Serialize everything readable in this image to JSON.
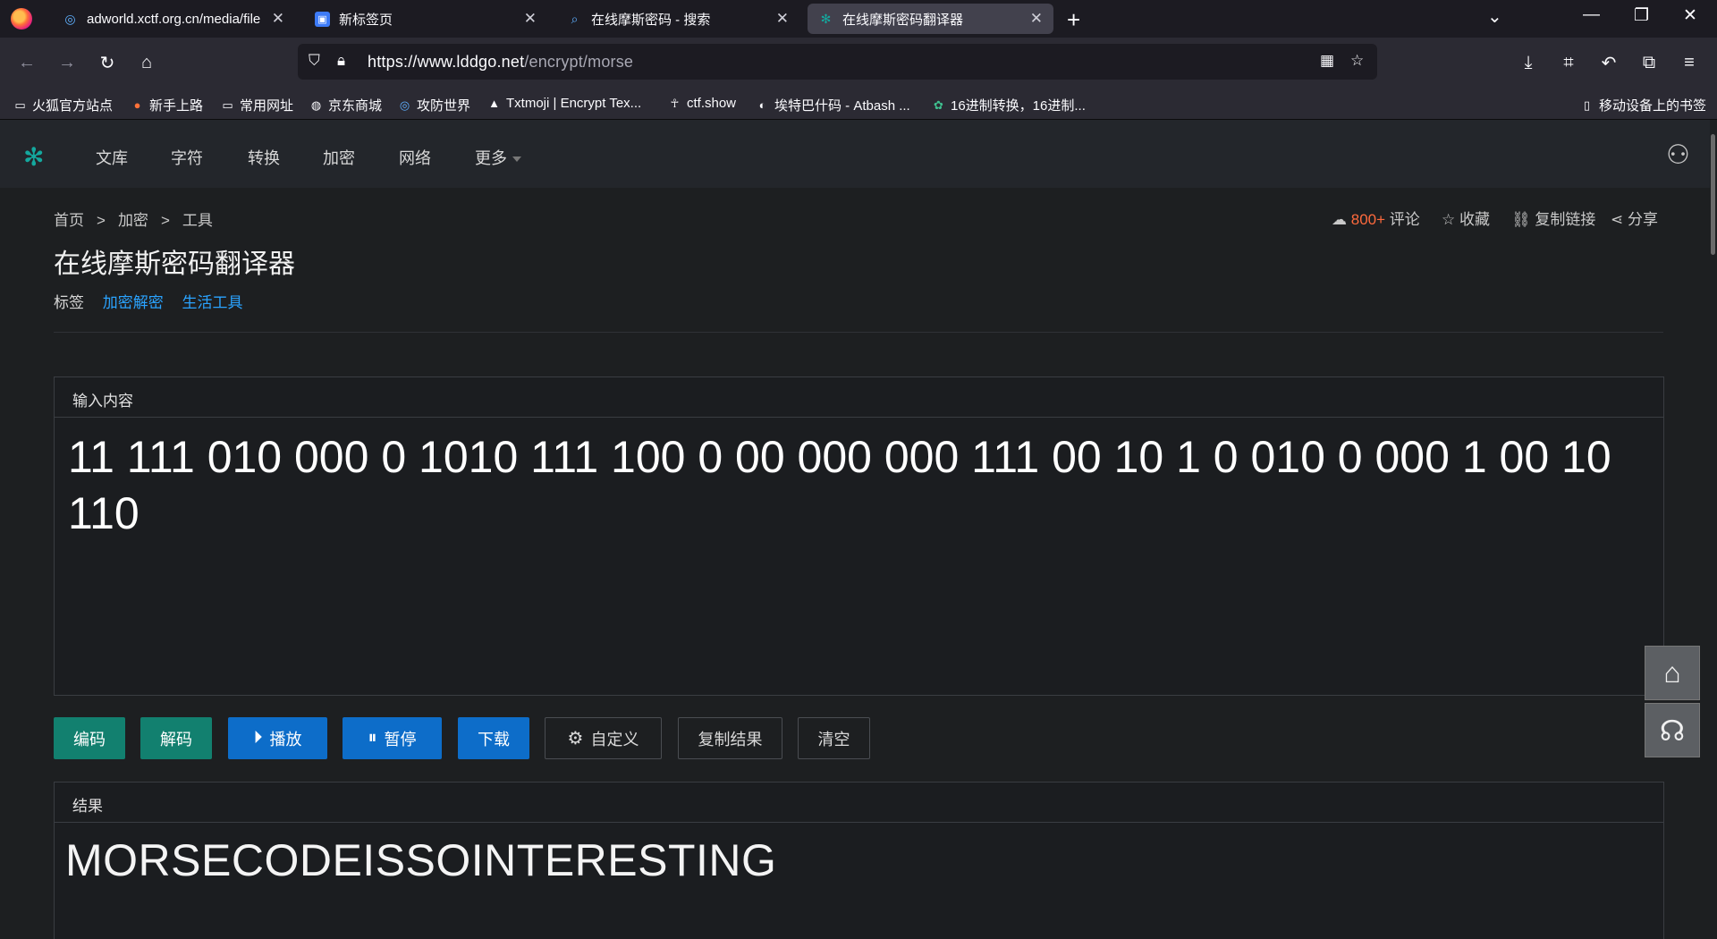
{
  "browser": {
    "tabs": [
      {
        "title": "adworld.xctf.org.cn/media/file",
        "icon": "globe-icon",
        "active": false
      },
      {
        "title": "新标签页",
        "icon": "newtab-icon",
        "active": false
      },
      {
        "title": "在线摩斯密码 - 搜索",
        "icon": "search-icon",
        "active": false
      },
      {
        "title": "在线摩斯密码翻译器",
        "icon": "site-icon",
        "active": true
      }
    ],
    "url_domain": "https://www.lddgo.net",
    "url_path": "/encrypt/morse",
    "bookmarks": [
      {
        "label": "火狐官方站点",
        "icon": "folder-icon"
      },
      {
        "label": "新手上路",
        "icon": "firefox-icon"
      },
      {
        "label": "常用网址",
        "icon": "folder-icon"
      },
      {
        "label": "京东商城",
        "icon": "globe-icon"
      },
      {
        "label": "攻防世界",
        "icon": "globe-icon"
      },
      {
        "label": "Txtmoji | Encrypt Tex...",
        "icon": "triangle-icon"
      },
      {
        "label": "ctf.show",
        "icon": "runner-icon"
      },
      {
        "label": "埃特巴什码 - Atbash ...",
        "icon": "circle-icon"
      },
      {
        "label": "16进制转换，16进制...",
        "icon": "gear-icon"
      }
    ],
    "mobile_bookmarks": "移动设备上的书签"
  },
  "site": {
    "nav": [
      "文库",
      "字符",
      "转换",
      "加密",
      "网络",
      "更多"
    ],
    "breadcrumb": [
      "首页",
      "加密",
      "工具"
    ],
    "comments_count": "800+",
    "comments_label": "评论",
    "favorite": "收藏",
    "copy_link": "复制链接",
    "share": "分享",
    "title": "在线摩斯密码翻译器",
    "tags_label": "标签",
    "tags": [
      "加密解密",
      "生活工具"
    ],
    "input_label": "输入内容",
    "input_value": "11 111 010 000 0 1010 111 100 0 00 000 000 111 00 10 1 0 010 0 000 1 00 10 110",
    "buttons": {
      "encode": "编码",
      "decode": "解码",
      "play": "播放",
      "pause": "暂停",
      "download": "下载",
      "custom": "自定义",
      "copy_result": "复制结果",
      "clear": "清空"
    },
    "result_label": "结果",
    "result_value": "MORSECODEISSOINTERESTING"
  },
  "colors": {
    "green_button": "#12806f",
    "blue_button": "#0d6dc9",
    "tag_link": "#2aa3ff",
    "hot_count": "#ff6a3d"
  }
}
